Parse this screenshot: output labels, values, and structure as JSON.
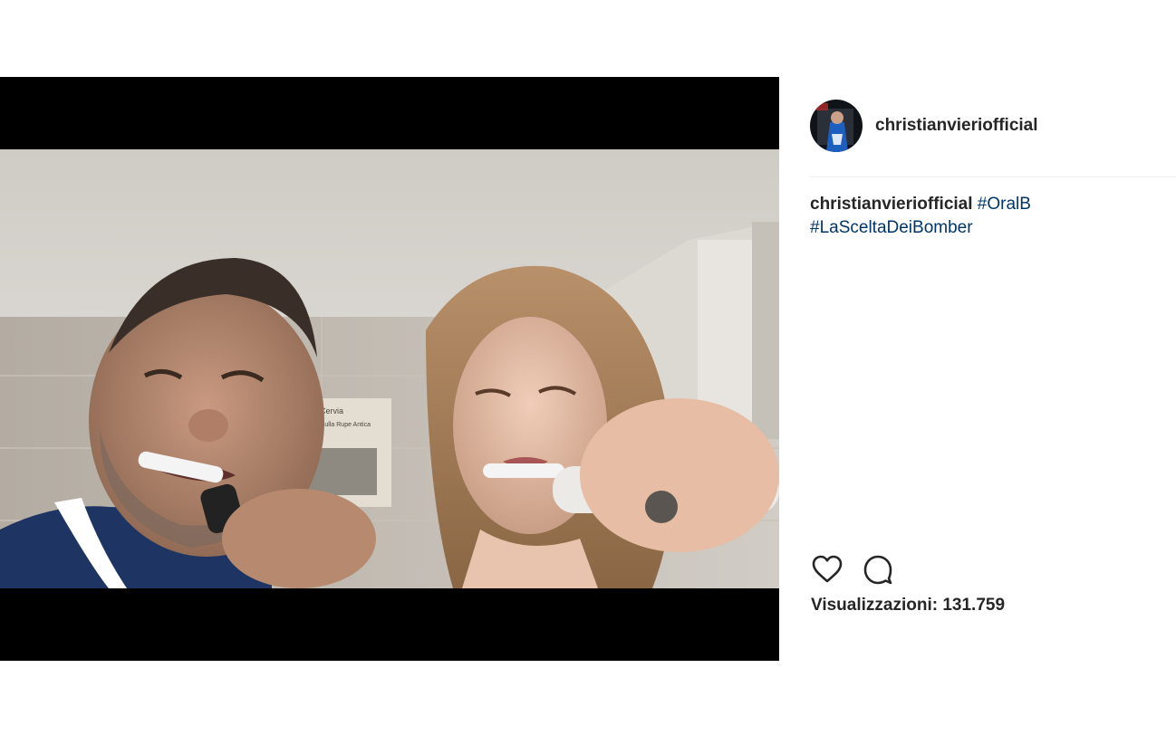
{
  "post": {
    "username": "christianvieriofficial",
    "caption": {
      "username": "christianvieriofficial",
      "hashtags": [
        "#OralB",
        "#LaSceltaDeiBomber"
      ]
    },
    "views_label": "Visualizzazioni:",
    "views_count": "131.759"
  },
  "video": {
    "poster_text_line1": "Cervia",
    "poster_text_line2": "Foto Stati sulla Rupe Antica"
  },
  "icons": {
    "like": "heart-icon",
    "comment": "comment-icon"
  },
  "colors": {
    "background": "#ffffff",
    "video_bars": "#000000",
    "text": "#262626",
    "hashtag": "#003569",
    "divider": "#efefef"
  }
}
